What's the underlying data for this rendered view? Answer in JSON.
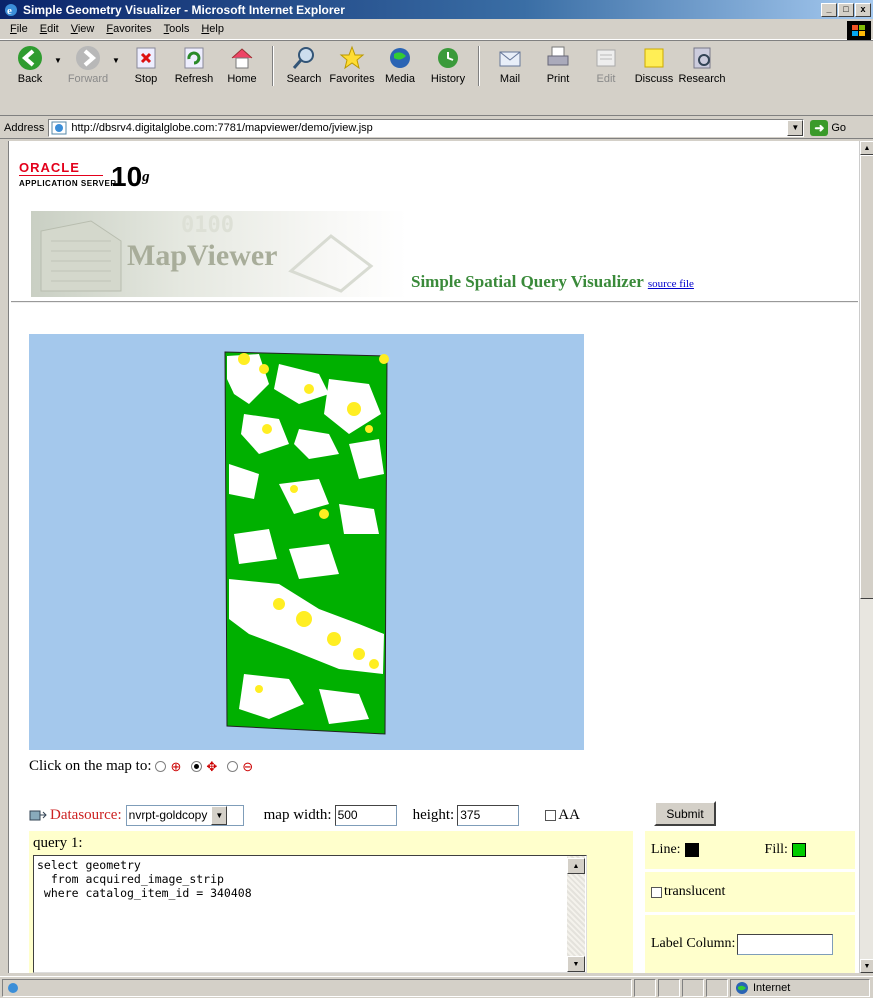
{
  "window": {
    "title": "Simple Geometry Visualizer - Microsoft Internet Explorer",
    "min": "_",
    "max": "□",
    "close": "x"
  },
  "menu": [
    {
      "first": "F",
      "rest": "ile"
    },
    {
      "first": "E",
      "rest": "dit"
    },
    {
      "first": "V",
      "rest": "iew"
    },
    {
      "first": "F",
      "rest": "avorites",
      "pre": ""
    },
    {
      "first": "T",
      "rest": "ools"
    },
    {
      "first": "H",
      "rest": "elp"
    }
  ],
  "toolbar": {
    "back": "Back",
    "forward": "Forward",
    "stop": "Stop",
    "refresh": "Refresh",
    "home": "Home",
    "search": "Search",
    "favorites": "Favorites",
    "media": "Media",
    "history": "History",
    "mail": "Mail",
    "print": "Print",
    "edit": "Edit",
    "discuss": "Discuss",
    "research": "Research"
  },
  "address": {
    "label": "Address",
    "url": "http://dbsrv4.digitalglobe.com:7781/mapviewer/demo/jview.jsp",
    "go": "Go"
  },
  "page": {
    "oracle": "ORACLE",
    "app_server": "APPLICATION SERVER",
    "version": "10",
    "version_suffix": "g",
    "banner": "MapViewer",
    "banner_digits": "0100",
    "title": "Simple Spatial Query Visualizer",
    "source_link": "source file"
  },
  "controls": {
    "click_label": "Click on the map to:",
    "zoom_mode": "pan",
    "datasource_label": "Datasource:",
    "datasource": "nvrpt-goldcopy",
    "width_label": "map width:",
    "width": "500",
    "height_label": "height:",
    "height": "375",
    "aa_label": "AA",
    "submit": "Submit"
  },
  "query": {
    "label": "query 1:",
    "sql": "select geometry\n  from acquired_image_strip\n where catalog_item_id = 340408"
  },
  "options": {
    "line_label": "Line:",
    "line_color": "#000000",
    "fill_label": "Fill:",
    "fill_color": "#00cc00",
    "translucent_label": "translucent",
    "label_column_label": "Label Column:"
  },
  "colors": {
    "map_background": "#a4c8ec",
    "strip_fill": "#00b000",
    "cloud": "#ffffff",
    "cloud_yellow": "#ffee22"
  },
  "status": {
    "zone": "Internet"
  }
}
